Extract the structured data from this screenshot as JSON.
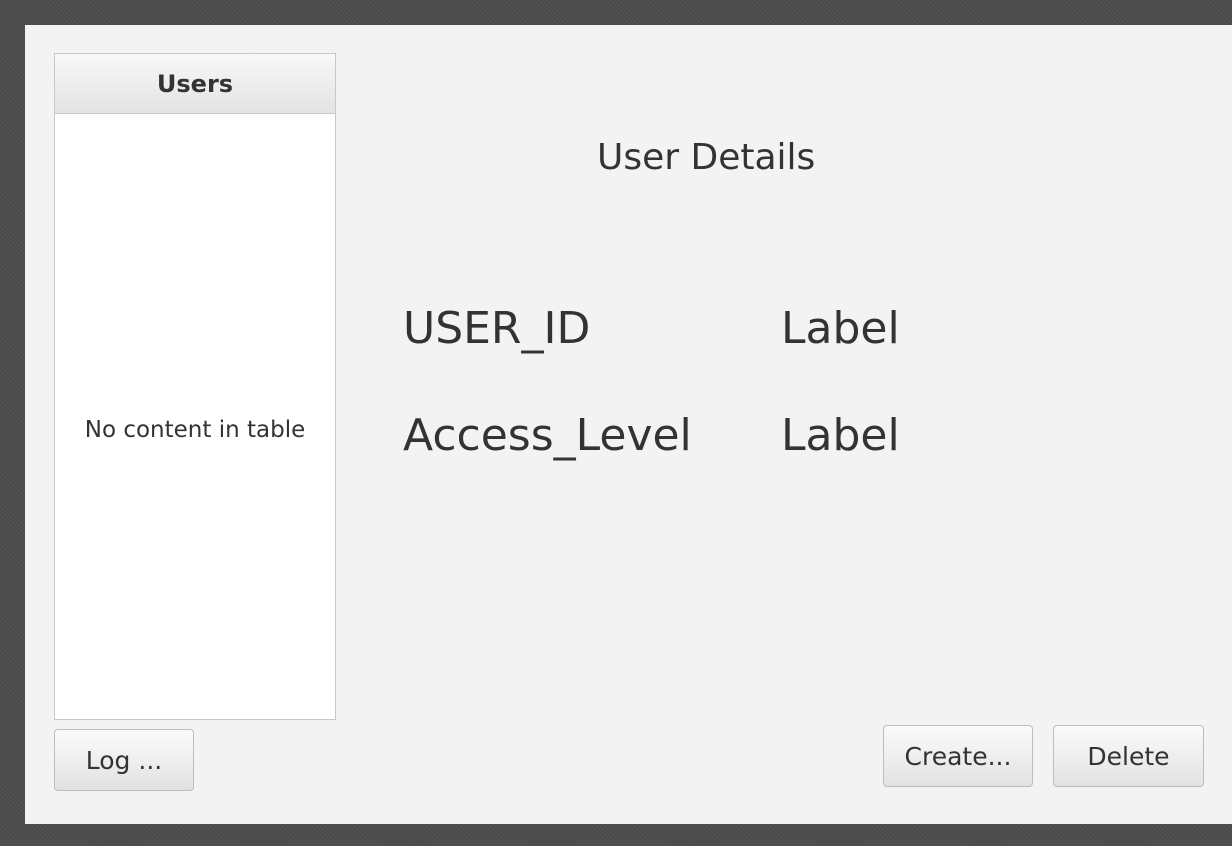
{
  "users_table": {
    "header": "Users",
    "empty_text": "No content in table"
  },
  "details": {
    "title": "User Details",
    "rows": [
      {
        "key": "USER_ID",
        "value": "Label"
      },
      {
        "key": "Access_Level",
        "value": "Label"
      }
    ]
  },
  "buttons": {
    "log": "Log ...",
    "create": "Create...",
    "delete": "Delete"
  }
}
